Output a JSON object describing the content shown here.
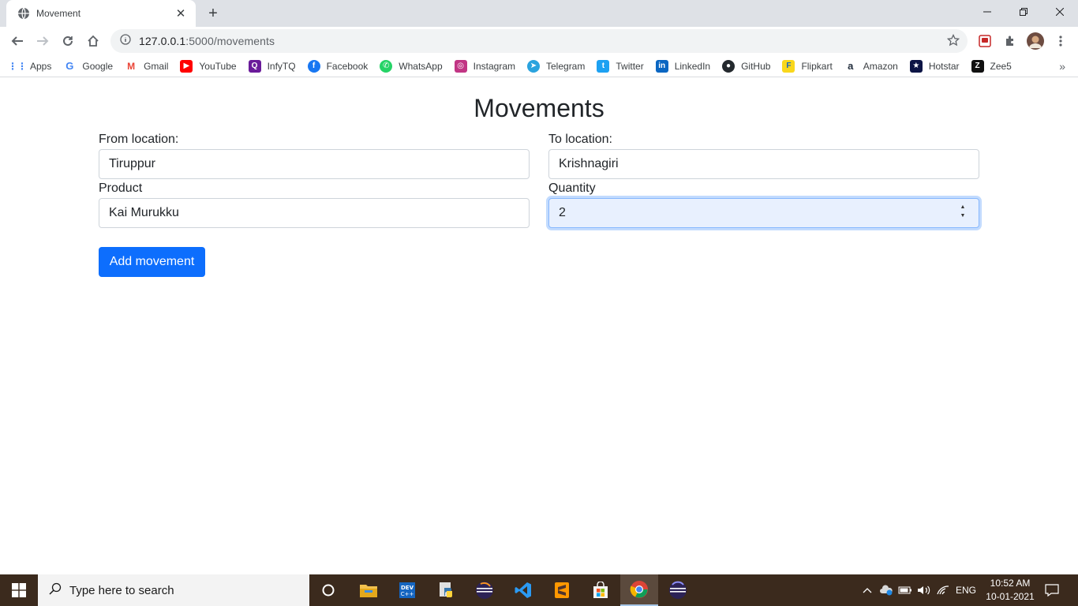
{
  "browser": {
    "tab_title": "Movement",
    "url_host": "127.0.0.1",
    "url_path": ":5000/movements",
    "bookmarks": [
      {
        "label": "Apps",
        "icon": "apps-grid-icon",
        "color": "#4285f4"
      },
      {
        "label": "Google",
        "icon": "google-icon",
        "color": "#4285f4"
      },
      {
        "label": "Gmail",
        "icon": "gmail-icon",
        "color": "#ea4335"
      },
      {
        "label": "YouTube",
        "icon": "youtube-icon",
        "color": "#ff0000"
      },
      {
        "label": "InfyTQ",
        "icon": "infytq-icon",
        "color": "#6a1b9a"
      },
      {
        "label": "Facebook",
        "icon": "facebook-icon",
        "color": "#1877f2"
      },
      {
        "label": "WhatsApp",
        "icon": "whatsapp-icon",
        "color": "#25d366"
      },
      {
        "label": "Instagram",
        "icon": "instagram-icon",
        "color": "#c13584"
      },
      {
        "label": "Telegram",
        "icon": "telegram-icon",
        "color": "#2aa3de"
      },
      {
        "label": "Twitter",
        "icon": "twitter-icon",
        "color": "#1da1f2"
      },
      {
        "label": "LinkedIn",
        "icon": "linkedin-icon",
        "color": "#0a66c2"
      },
      {
        "label": "GitHub",
        "icon": "github-icon",
        "color": "#24292e"
      },
      {
        "label": "Flipkart",
        "icon": "flipkart-icon",
        "color": "#f9d71c"
      },
      {
        "label": "Amazon",
        "icon": "amazon-icon",
        "color": "#232f3e"
      },
      {
        "label": "Hotstar",
        "icon": "hotstar-icon",
        "color": "#0c1445"
      },
      {
        "label": "Zee5",
        "icon": "zee5-icon",
        "color": "#111111"
      }
    ]
  },
  "page": {
    "title": "Movements",
    "from_location": {
      "label": "From location:",
      "value": "Tiruppur"
    },
    "to_location": {
      "label": "To location:",
      "value": "Krishnagiri"
    },
    "product": {
      "label": "Product",
      "value": "Kai Murukku"
    },
    "quantity": {
      "label": "Quantity",
      "value": "2"
    },
    "submit_label": "Add movement",
    "accent_color": "#0d6efd"
  },
  "taskbar": {
    "search_placeholder": "Type here to search",
    "language": "ENG",
    "time": "10:52 AM",
    "date": "10-01-2021"
  }
}
